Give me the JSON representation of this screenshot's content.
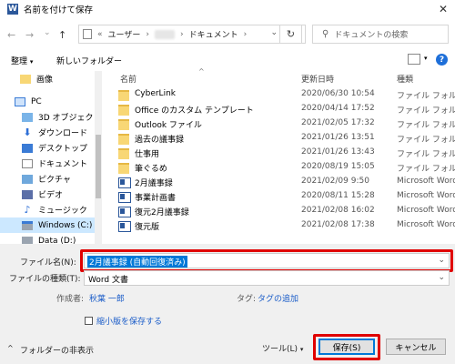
{
  "window": {
    "title": "名前を付けて保存",
    "app_icon_letter": "W",
    "close_glyph": "✕"
  },
  "nav": {
    "back": "←",
    "forward": "→",
    "recent": "⌄",
    "up": "↑",
    "address": {
      "prefix": "«",
      "segments": [
        "ユーザー",
        "ドキュメント"
      ],
      "sep": "›"
    },
    "refresh": "↻",
    "search_placeholder": "ドキュメントの検索"
  },
  "toolbar": {
    "organize": "整理",
    "new_folder": "新しいフォルダー",
    "help": "?"
  },
  "sidebar": {
    "items": [
      {
        "label": "画像",
        "icon": "pictures-folder-icon"
      },
      {
        "label": "PC",
        "icon": "pc-icon"
      },
      {
        "label": "3D オブジェクト",
        "icon": "3d-objects-icon"
      },
      {
        "label": "ダウンロード",
        "icon": "download-icon"
      },
      {
        "label": "デスクトップ",
        "icon": "desktop-icon"
      },
      {
        "label": "ドキュメント",
        "icon": "documents-icon"
      },
      {
        "label": "ピクチャ",
        "icon": "pictures-icon"
      },
      {
        "label": "ビデオ",
        "icon": "video-icon"
      },
      {
        "label": "ミュージック",
        "icon": "music-icon"
      },
      {
        "label": "Windows (C:)",
        "icon": "drive-icon"
      },
      {
        "label": "Data (D:)",
        "icon": "drive-icon"
      }
    ]
  },
  "files": {
    "columns": [
      "名前",
      "更新日時",
      "種類"
    ],
    "sort_indicator": "^",
    "rows": [
      {
        "name": "CyberLink",
        "date": "2020/06/30 10:54",
        "type": "ファイル フォル",
        "kind": "folder"
      },
      {
        "name": "Office のカスタム テンプレート",
        "date": "2020/04/14 17:52",
        "type": "ファイル フォル",
        "kind": "folder"
      },
      {
        "name": "Outlook ファイル",
        "date": "2021/02/05 17:32",
        "type": "ファイル フォル",
        "kind": "folder"
      },
      {
        "name": "過去の議事録",
        "date": "2021/01/26 13:51",
        "type": "ファイル フォル",
        "kind": "folder"
      },
      {
        "name": "仕事用",
        "date": "2021/01/26 13:43",
        "type": "ファイル フォル",
        "kind": "folder"
      },
      {
        "name": "筆ぐるめ",
        "date": "2020/08/19 15:05",
        "type": "ファイル フォル",
        "kind": "folder"
      },
      {
        "name": "2月議事録",
        "date": "2021/02/09 9:50",
        "type": "Microsoft Word",
        "kind": "word"
      },
      {
        "name": "事業計画書",
        "date": "2020/08/11 15:28",
        "type": "Microsoft Word",
        "kind": "word"
      },
      {
        "name": "復元2月議事録",
        "date": "2021/02/08 16:02",
        "type": "Microsoft Word",
        "kind": "word"
      },
      {
        "name": "復元版",
        "date": "2021/02/08 17:38",
        "type": "Microsoft Word",
        "kind": "word"
      }
    ]
  },
  "form": {
    "filename_label": "ファイル名(N):",
    "filename_value": "2月議事録 (自動回復済み)",
    "filetype_label": "ファイルの種類(T):",
    "filetype_value": "Word 文書",
    "author_label": "作成者:",
    "author_value": "秋葉 一郎",
    "tag_label": "タグ:",
    "tag_value": "タグの追加",
    "thumbnail_label": "縮小版を保存する",
    "hide_folders": "フォルダーの非表示",
    "tools": "ツール(L)",
    "save": "保存(S)",
    "cancel": "キャンセル",
    "dropdown_arrow": "⌄"
  },
  "colors": {
    "highlight": "#e00000",
    "accent": "#0078d7",
    "folder": "#f8d775",
    "word": "#2b579a"
  }
}
